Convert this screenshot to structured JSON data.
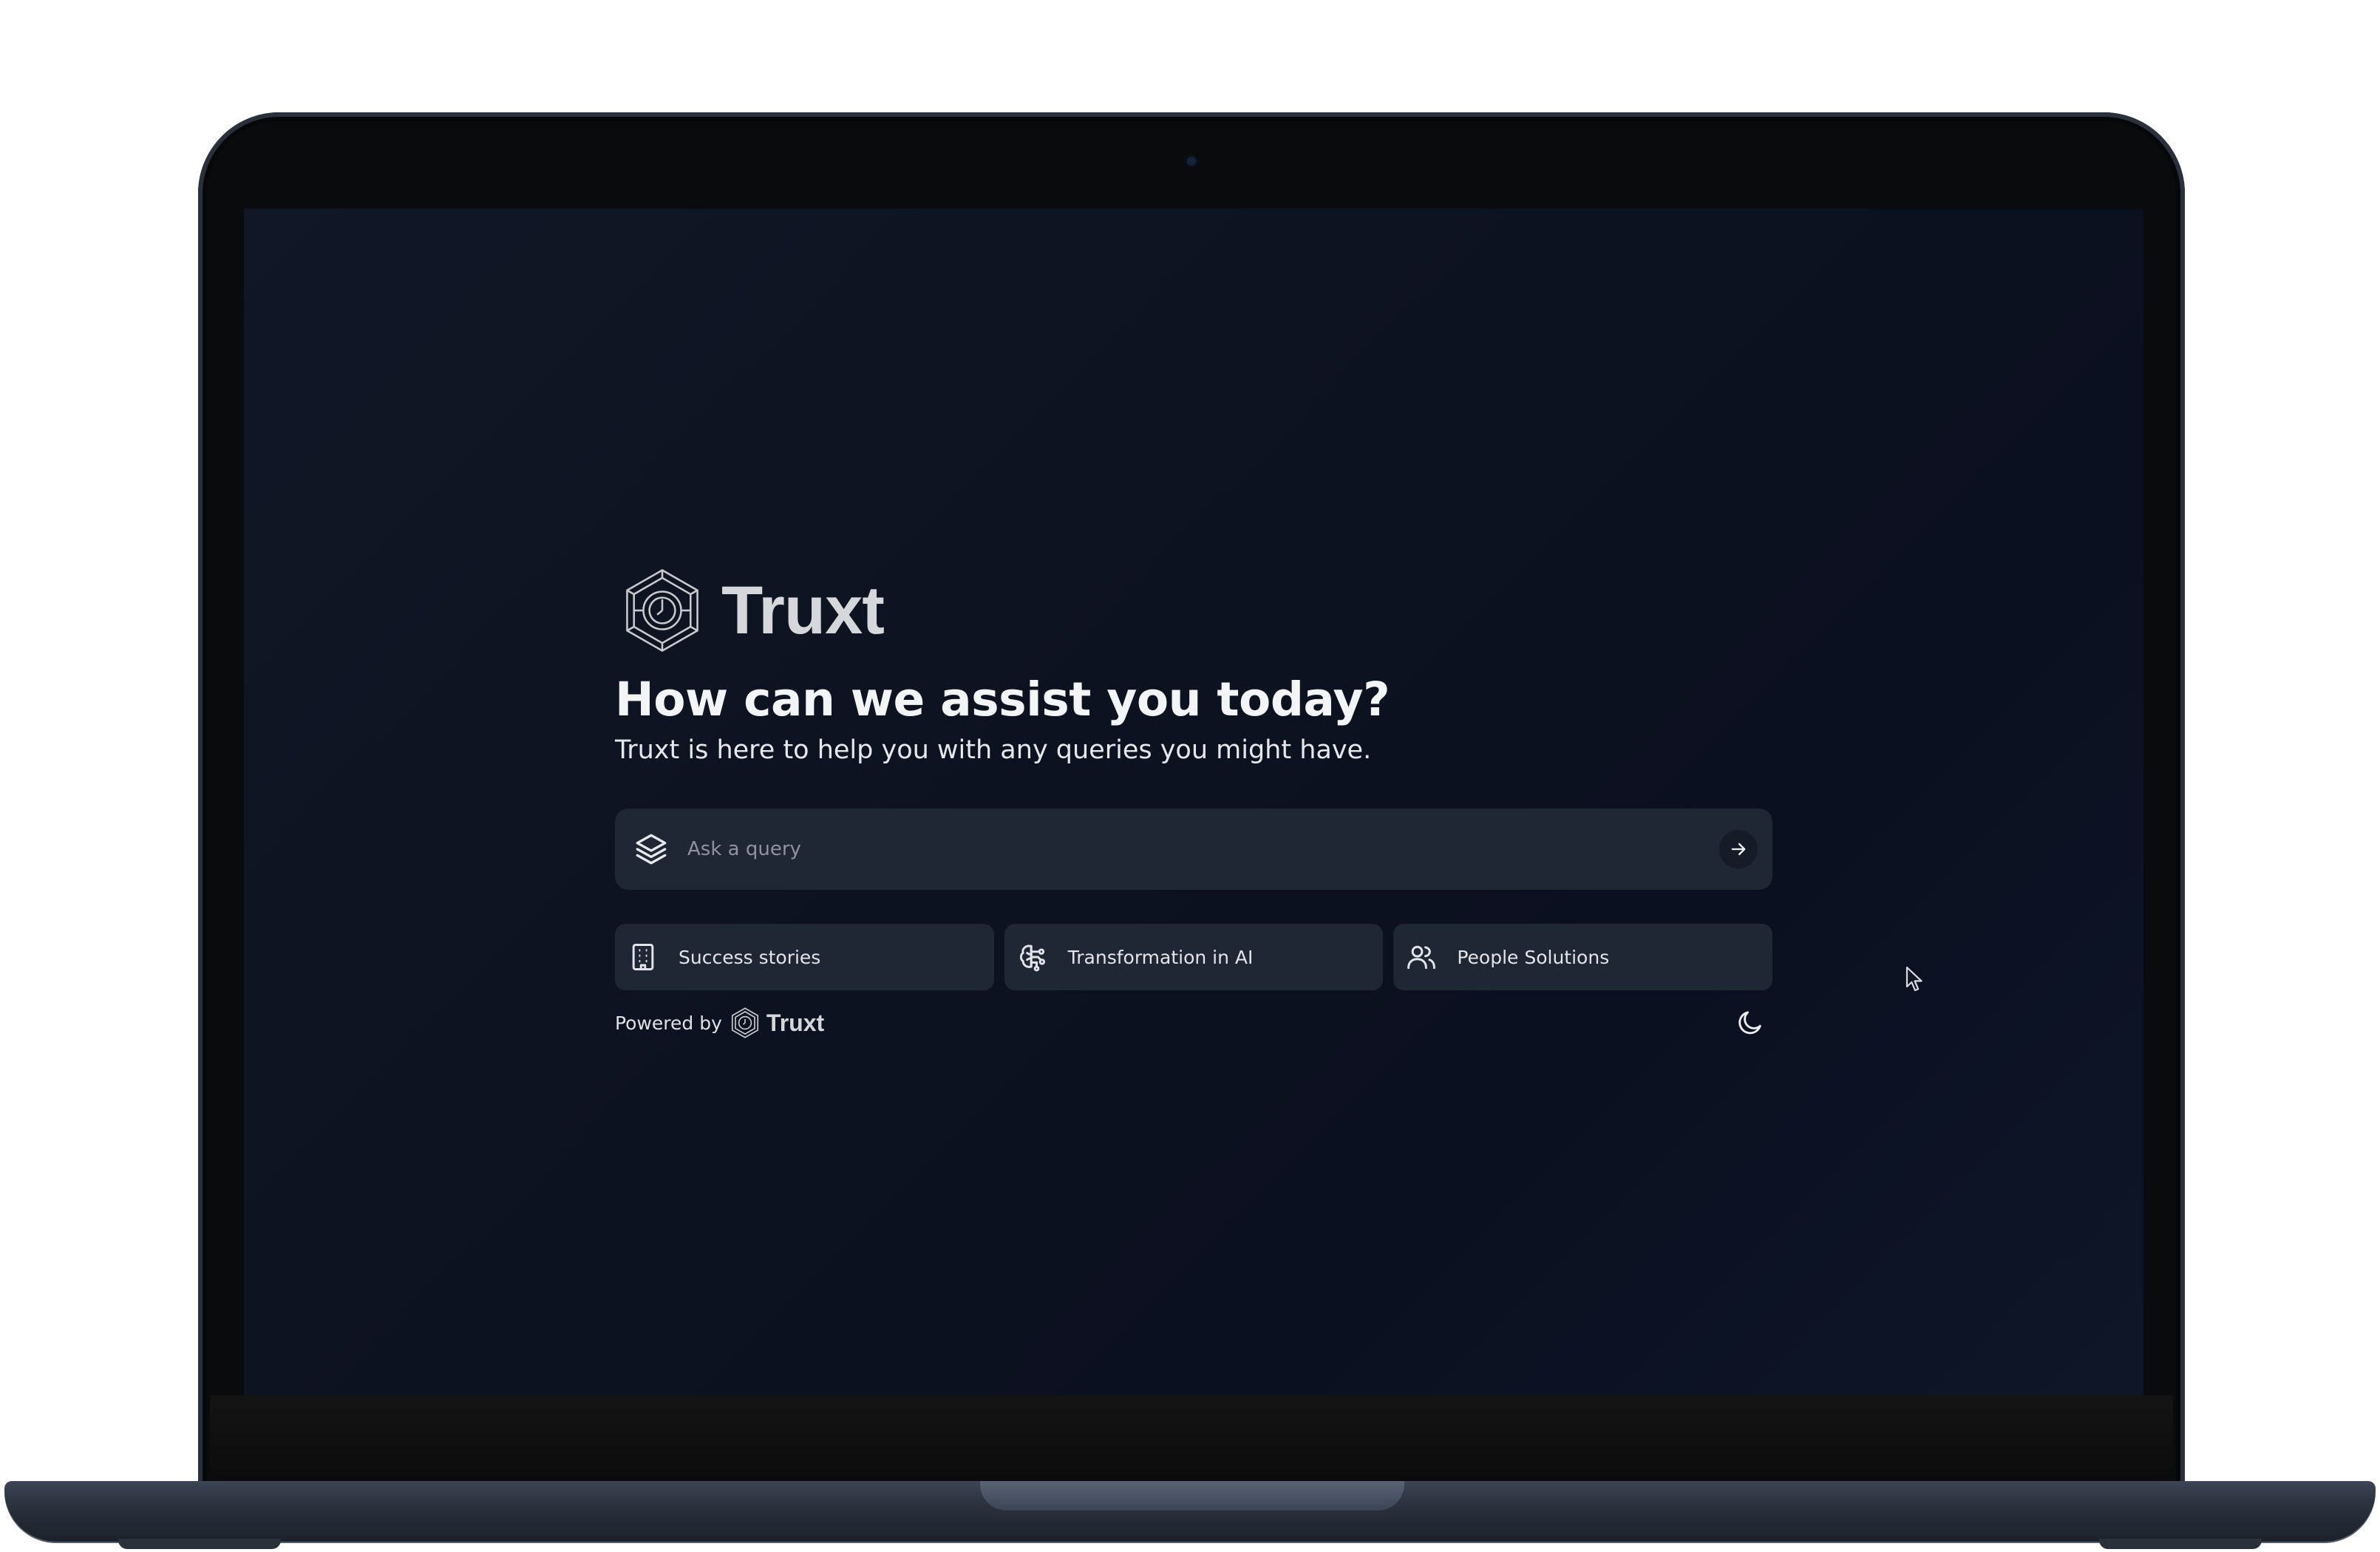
{
  "brand": {
    "name": "Truxt",
    "logo_icon": "hexagon-clock-logo-icon"
  },
  "hero": {
    "headline": "How can we assist you today?",
    "subline": "Truxt is here to help you with any queries you might have."
  },
  "search": {
    "placeholder": "Ask a query",
    "value": "",
    "leading_icon": "layers-icon",
    "submit_icon": "arrow-right-icon"
  },
  "suggestions": [
    {
      "label": "Success stories",
      "icon": "building-icon"
    },
    {
      "label": "Transformation in AI",
      "icon": "brain-icon"
    },
    {
      "label": "People Solutions",
      "icon": "users-icon"
    }
  ],
  "footer": {
    "powered_by": "Powered by",
    "brand_name": "Truxt",
    "theme_toggle_icon": "moon-icon"
  },
  "colors": {
    "background": "#0d1220",
    "surface": "#1f2634",
    "text_primary": "#f3f4f6",
    "text_muted": "#8d93a0",
    "brand_text": "#d6d7da"
  }
}
